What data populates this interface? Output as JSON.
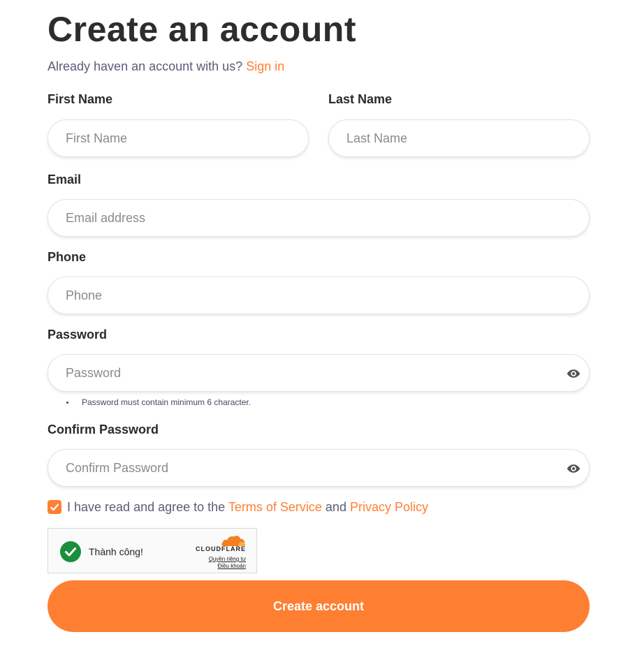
{
  "page": {
    "title": "Create an account",
    "signin_prompt": "Already haven an account with us?",
    "signin_link": "Sign in"
  },
  "form": {
    "first_name": {
      "label": "First Name",
      "placeholder": "First Name",
      "value": ""
    },
    "last_name": {
      "label": "Last Name",
      "placeholder": "Last Name",
      "value": ""
    },
    "email": {
      "label": "Email",
      "placeholder": "Email address",
      "value": ""
    },
    "phone": {
      "label": "Phone",
      "placeholder": "Phone",
      "value": ""
    },
    "password": {
      "label": "Password",
      "placeholder": "Password",
      "value": "",
      "hint": "Password must contain minimum 6 character."
    },
    "confirm_password": {
      "label": "Confirm Password",
      "placeholder": "Confirm Password",
      "value": ""
    },
    "agreement": {
      "checked": true,
      "prefix": "I have read and agree to the",
      "terms_link": "Terms of Service",
      "conjunction": "and",
      "privacy_link": "Privacy Policy"
    },
    "captcha": {
      "status": "Thành công!",
      "brand": "CLOUDFLARE",
      "privacy_link": "Quyền riêng tư",
      "terms_link": "Điều khoản"
    },
    "submit_label": "Create account"
  },
  "icons": {
    "password_toggle": "eye-icon",
    "checkbox": "checkmark-icon",
    "captcha_success": "check-circle-icon",
    "captcha_logo": "cloudflare-cloud-icon"
  },
  "colors": {
    "accent": "#ff7f32",
    "text_primary": "#2b2b2b",
    "text_muted": "#5b5b7a",
    "success": "#1a8f3c"
  }
}
